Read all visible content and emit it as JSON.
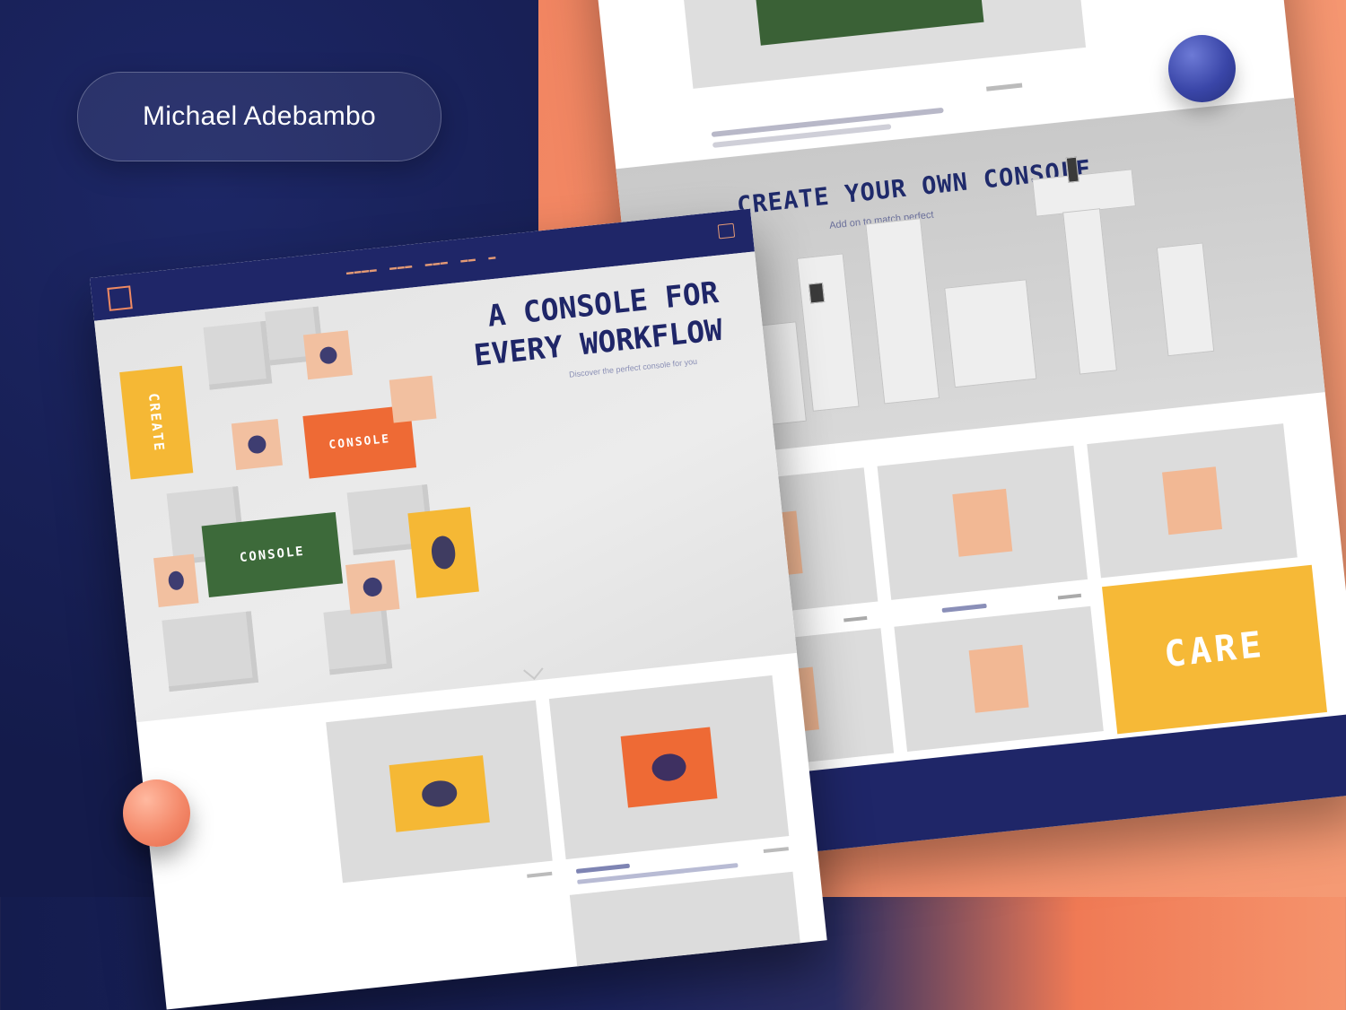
{
  "author": {
    "name": "Michael Adebambo"
  },
  "front_page": {
    "hero": {
      "title_line1": "A CONSOLE FOR",
      "title_line2": "EVERY WORKFLOW",
      "subtitle": "Discover the perfect console for you",
      "cta_icon": "chevron-down-icon"
    },
    "package_text": {
      "create": "CREATE",
      "console": "CONSOLE"
    }
  },
  "back_page": {
    "section": {
      "title": "CREATE YOUR OWN CONSOLE",
      "subtitle": "Add on to match perfect"
    },
    "care_card": {
      "label": "CARE"
    }
  },
  "colors": {
    "navy": "#1f2668",
    "orange": "#ee6a35",
    "green": "#3d6a3a",
    "yellow": "#f5b835",
    "peach": "#f2c0a0",
    "background_left": "#141b4b",
    "background_right": "#f28662"
  }
}
